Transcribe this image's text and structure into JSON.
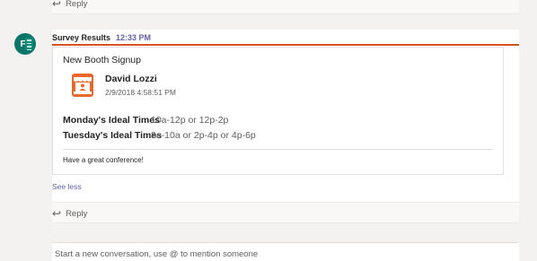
{
  "thread": {
    "prev_reply_label": "Reply",
    "reply_label": "Reply"
  },
  "message": {
    "author": "Survey Results",
    "time": "12:33 PM",
    "avatar_letter": "F",
    "avatar_icon": "forms-icon",
    "card": {
      "title": "New Booth Signup",
      "booth_icon": "booth-icon",
      "person_name": "David Lozzi",
      "person_date": "2/9/2018 4:58:51 PM",
      "facts": [
        {
          "label": "Monday's Ideal Times",
          "value": "10a-12p or 12p-2p"
        },
        {
          "label": "Tuesday's Ideal Times",
          "value": "8a-10a or 2p-4p or 4p-6p"
        }
      ],
      "note": "Have a great conference!"
    },
    "see_less": "See less"
  },
  "composer": {
    "placeholder": "Start a new conversation, use @ to mention someone"
  },
  "colors": {
    "accent": "#6264a7",
    "card_rule": "#d7511f",
    "avatar_bg": "#077568"
  }
}
